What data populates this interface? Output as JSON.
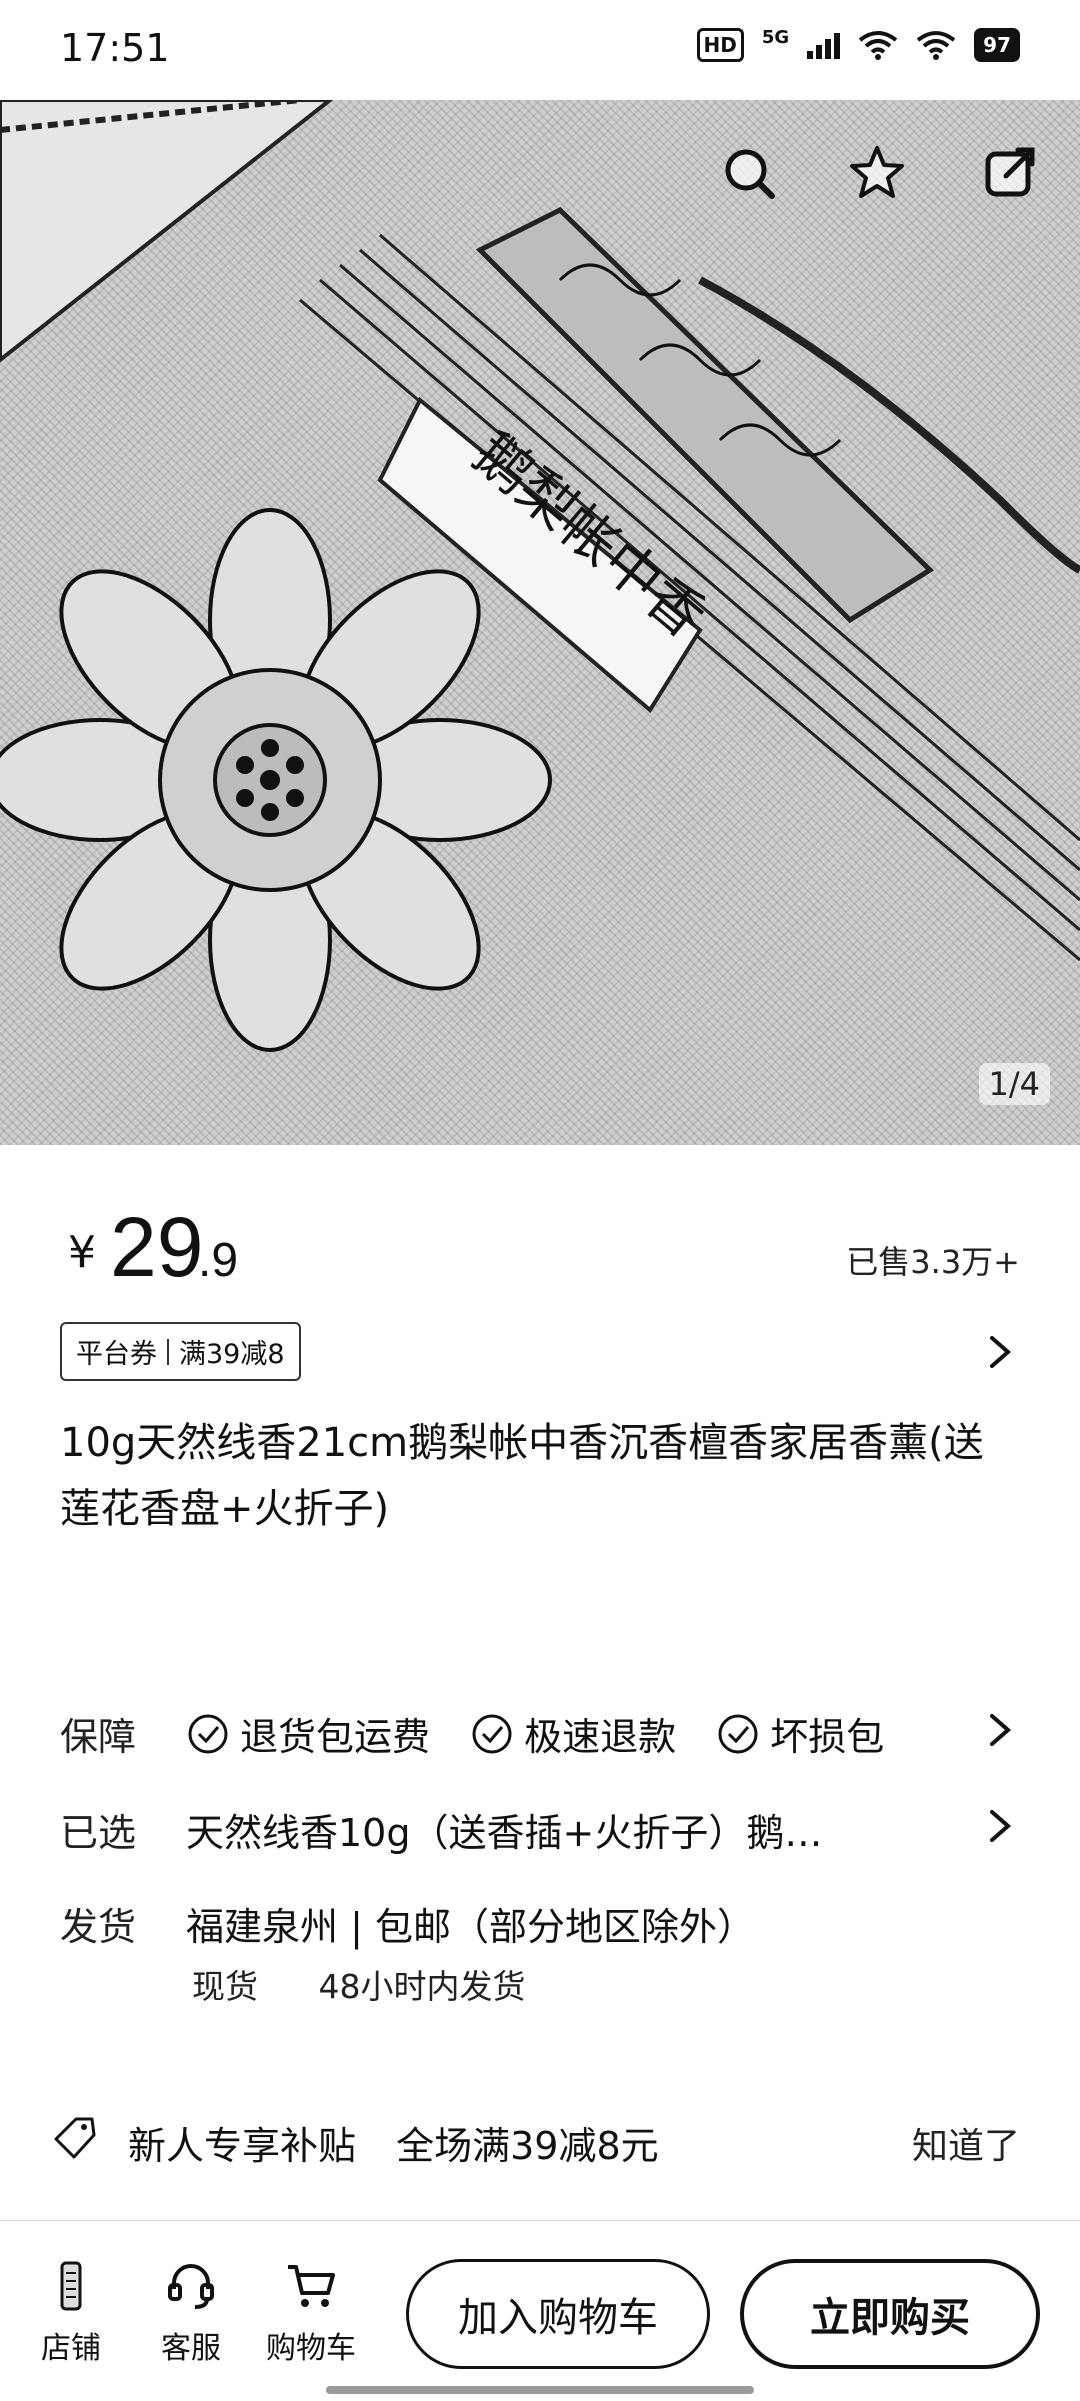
{
  "status_bar": {
    "time": "17:51",
    "hd_label": "HD",
    "network_label": "5G",
    "battery_label": "97"
  },
  "hero": {
    "image_counter": "1/4",
    "incense_label": "鹅梨帐中香",
    "actions": [
      "search-icon",
      "star-icon",
      "share-icon"
    ]
  },
  "product": {
    "currency": "¥",
    "price_int": "29",
    "price_dec": ".9",
    "sold": "已售3.3万+",
    "coupon_type": "平台券",
    "coupon_value": "满39减8",
    "title": "10g天然线香21cm鹅梨帐中香沉香檀香家居香薰(送莲花香盘+火折子)"
  },
  "info": {
    "guarantee_label": "保障",
    "guarantees": [
      "退货包运费",
      "极速退款",
      "坏损包"
    ],
    "selected_label": "已选",
    "selected_value": "天然线香10g（送香插+火折子）鹅…",
    "shipping_label": "发货",
    "shipping_value": "福建泉州 | 包邮（部分地区除外）",
    "stock": "现货",
    "ship_time": "48小时内发货"
  },
  "promo": {
    "text1": "新人专享补贴",
    "text2": "全场满39减8元",
    "dismiss": "知道了"
  },
  "bottom_bar": {
    "shop": "店铺",
    "service": "客服",
    "cart": "购物车",
    "add_to_cart": "加入购物车",
    "buy_now": "立即购买"
  },
  "colors": {
    "text": "#111111",
    "background": "#ffffff",
    "hero_bg": "#cfcfcf"
  }
}
